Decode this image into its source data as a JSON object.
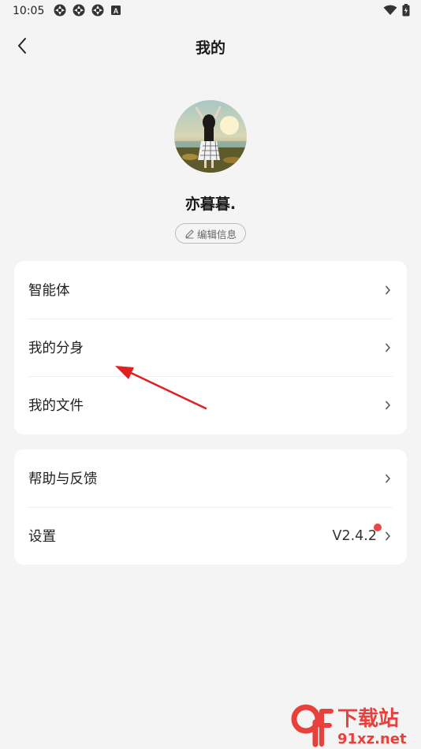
{
  "status_bar": {
    "time": "10:05",
    "left_icons": [
      "app-notification-icon",
      "app-notification-icon",
      "app-notification-icon",
      "keyboard-a-icon"
    ],
    "right_icons": [
      "wifi-icon",
      "battery-charging-icon"
    ]
  },
  "header": {
    "title": "我的",
    "back_icon": "chevron-left-icon"
  },
  "profile": {
    "username": "亦暮暮.",
    "edit_label": "编辑信息",
    "edit_icon": "pencil-icon"
  },
  "menu_group_1": [
    {
      "label": "智能体"
    },
    {
      "label": "我的分身"
    },
    {
      "label": "我的文件"
    }
  ],
  "menu_group_2": [
    {
      "label": "帮助与反馈"
    },
    {
      "label": "设置",
      "value": "V2.4.2",
      "badge_color": "#f04545"
    }
  ],
  "annotation": {
    "color": "#e02020"
  },
  "watermark": {
    "text_top": "下载站",
    "text_bottom": "91xz.net",
    "logo": "9f",
    "color": "#e8413c"
  }
}
